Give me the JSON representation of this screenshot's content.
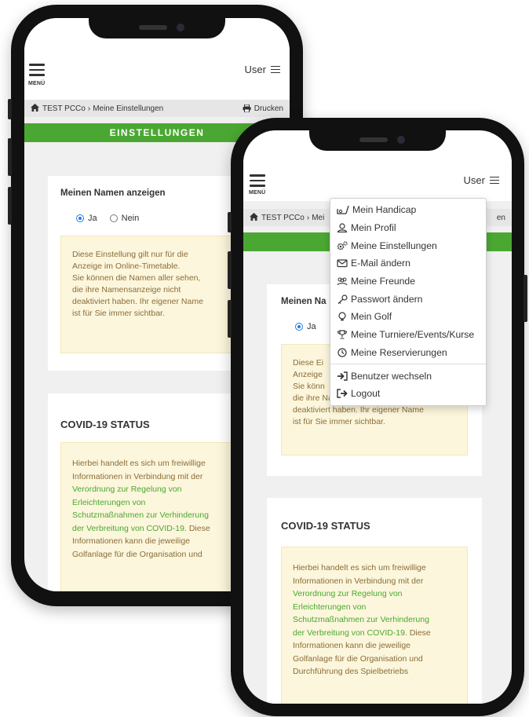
{
  "back_phone": {
    "menu_label": "MENÜ",
    "user_label": "User",
    "breadcrumb": {
      "home": "TEST PCCo",
      "separator": "›",
      "current": "Meine Einstellungen"
    },
    "print_label": "Drucken",
    "section_title": "EINSTELLUNGEN",
    "name_card": {
      "title": "Meinen Namen anzeigen",
      "option_yes": "Ja",
      "option_no": "Nein",
      "note_lines": [
        "Diese Einstellung gilt nur für die",
        "Anzeige im Online-Timetable.",
        "Sie können die Namen aller sehen,",
        "die ihre Namensanzeige nicht",
        "deaktiviert haben. Ihr eigener Name",
        "ist für Sie immer sichtbar."
      ]
    },
    "covid_card": {
      "title": "COVID-19 STATUS",
      "lines": [
        {
          "text": "Hierbei handelt es sich um freiwillige",
          "link": false
        },
        {
          "text": "Informationen in Verbindung mit der",
          "link": false
        },
        {
          "text": "Verordnung zur Regelung von",
          "link": true
        },
        {
          "text": "Erleichterungen von",
          "link": true
        },
        {
          "text": "Schutzmaßnahmen zur Verhinderung",
          "link": true
        },
        {
          "text": "der Verbreitung von COVID-19.",
          "link": true,
          "suffix": " Diese"
        },
        {
          "text": "Informationen kann die jeweilige",
          "link": false
        },
        {
          "text": "Golfanlage für die Organisation und",
          "link": false
        }
      ]
    }
  },
  "front_phone": {
    "menu_label": "MENÜ",
    "user_label": "User",
    "breadcrumb": {
      "home": "TEST PCCo",
      "separator": "›",
      "current": "Mei",
      "tail": "en"
    },
    "name_card": {
      "title": "Meinen Na",
      "option_yes": "Ja",
      "note_lines": [
        "Diese Ei",
        "Anzeige",
        "Sie könn",
        "die ihre Namensanzeige nicht",
        "deaktiviert haben. Ihr eigener Name",
        "ist für Sie immer sichtbar."
      ]
    },
    "covid_card": {
      "title": "COVID-19 STATUS",
      "lines": [
        {
          "text": "Hierbei handelt es sich um freiwillige",
          "link": false
        },
        {
          "text": "Informationen in Verbindung mit der",
          "link": false
        },
        {
          "text": "Verordnung zur Regelung von",
          "link": true
        },
        {
          "text": "Erleichterungen von",
          "link": true
        },
        {
          "text": "Schutzmaßnahmen zur Verhinderung",
          "link": true
        },
        {
          "text": "der Verbreitung von COVID-19.",
          "link": true,
          "suffix": " Diese"
        },
        {
          "text": "Informationen kann die jeweilige",
          "link": false
        },
        {
          "text": "Golfanlage für die Organisation und",
          "link": false
        },
        {
          "text": "Durchführung des Spielbetriebs",
          "link": false
        }
      ]
    },
    "dropdown": {
      "items": [
        {
          "label": "Mein Handicap",
          "icon": "handicap-icon"
        },
        {
          "label": "Mein Profil",
          "icon": "user-icon"
        },
        {
          "label": "Meine Einstellungen",
          "icon": "gears-icon"
        },
        {
          "label": "E-Mail ändern",
          "icon": "envelope-icon"
        },
        {
          "label": "Meine Freunde",
          "icon": "friends-icon"
        },
        {
          "label": "Passwort ändern",
          "icon": "key-icon"
        },
        {
          "label": "Mein Golf",
          "icon": "golf-ball-icon"
        },
        {
          "label": "Meine Turniere/Events/Kurse",
          "icon": "trophy-icon"
        },
        {
          "label": "Meine Reservierungen",
          "icon": "clock-icon"
        },
        {
          "label": "Benutzer wechseln",
          "icon": "switch-user-icon"
        },
        {
          "label": "Logout",
          "icon": "logout-icon"
        }
      ]
    }
  },
  "colors": {
    "accent_green": "#4aa832",
    "note_background": "#fcf6dc",
    "note_text": "#8a6d3b",
    "radio_blue": "#1e7be0"
  }
}
